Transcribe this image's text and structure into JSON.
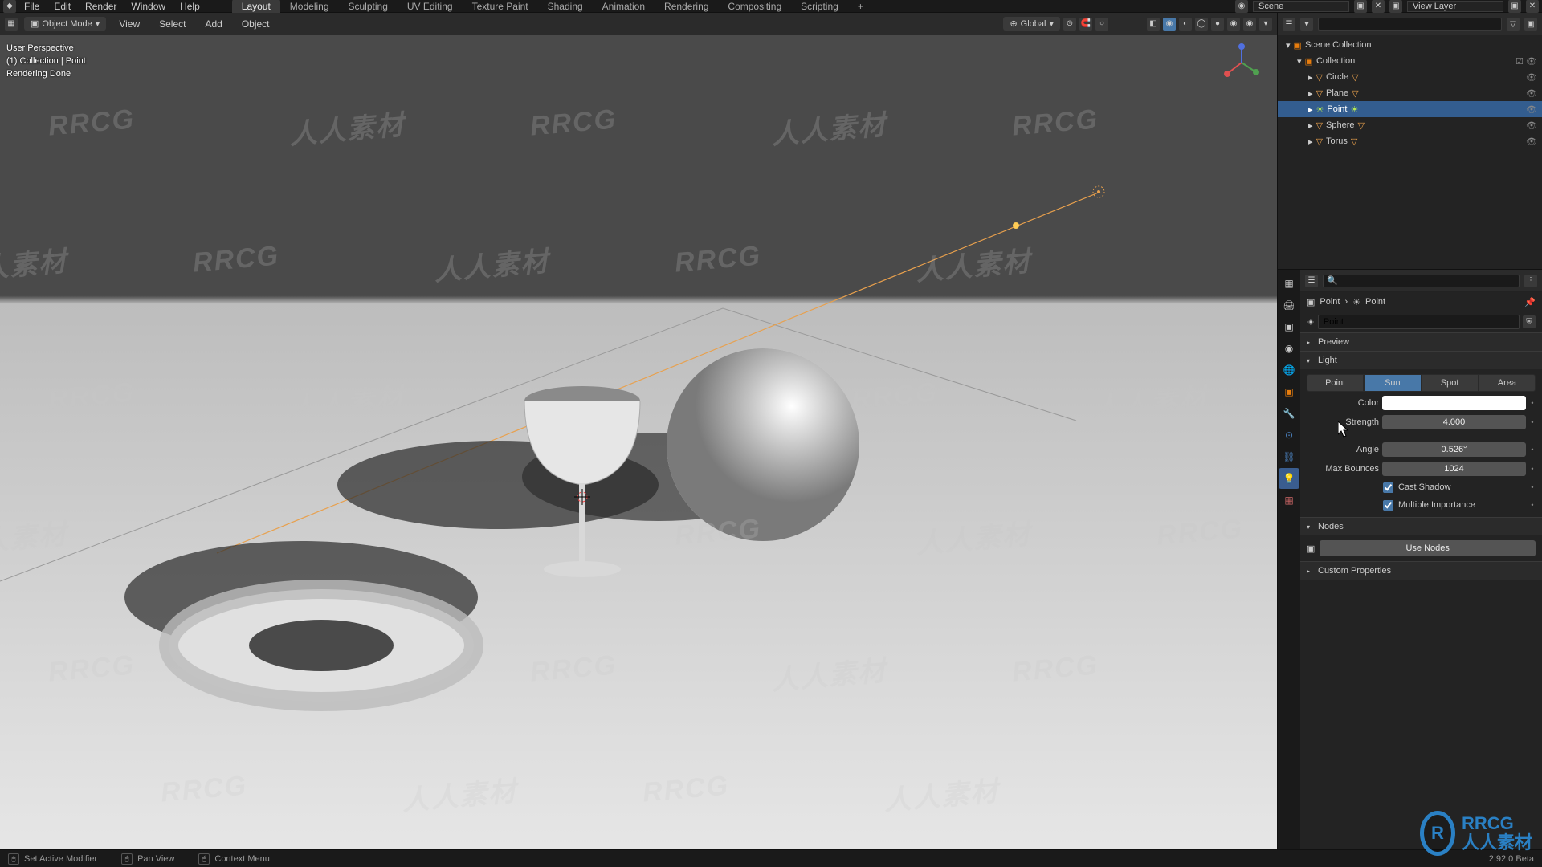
{
  "menubar": {
    "file": "File",
    "edit": "Edit",
    "render": "Render",
    "window": "Window",
    "help": "Help"
  },
  "workspaces": {
    "tabs": [
      "Layout",
      "Modeling",
      "Sculpting",
      "UV Editing",
      "Texture Paint",
      "Shading",
      "Animation",
      "Rendering",
      "Compositing",
      "Scripting"
    ],
    "active": "Layout",
    "add": "+"
  },
  "topright": {
    "scene_field": "Scene",
    "viewlayer_field": "View Layer"
  },
  "viewport_header": {
    "mode": "Object Mode",
    "view": "View",
    "select": "Select",
    "add": "Add",
    "object": "Object",
    "orientation": "Global"
  },
  "overlay": {
    "line1": "User Perspective",
    "line2": "(1) Collection | Point",
    "line3": "Rendering Done"
  },
  "outliner": {
    "root": "Scene Collection",
    "collection": "Collection",
    "items": [
      {
        "name": "Circle",
        "type": "mesh"
      },
      {
        "name": "Plane",
        "type": "mesh"
      },
      {
        "name": "Point",
        "type": "light",
        "selected": true
      },
      {
        "name": "Sphere",
        "type": "mesh"
      },
      {
        "name": "Torus",
        "type": "mesh"
      }
    ]
  },
  "properties": {
    "breadcrumb": {
      "obj": "Point",
      "data": "Point"
    },
    "name": "Point",
    "sections": {
      "preview": "Preview",
      "light": "Light",
      "nodes": "Nodes",
      "custom": "Custom Properties"
    },
    "light_types": [
      "Point",
      "Sun",
      "Spot",
      "Area"
    ],
    "light_type_active": "Sun",
    "color_label": "Color",
    "strength_label": "Strength",
    "strength": "4.000",
    "angle_label": "Angle",
    "angle": "0.526°",
    "bounces_label": "Max Bounces",
    "bounces": "1024",
    "cast_shadow": "Cast Shadow",
    "multi_importance": "Multiple Importance",
    "use_nodes": "Use Nodes"
  },
  "statusbar": {
    "set_modifier": "Set Active Modifier",
    "pan": "Pan View",
    "context": "Context Menu",
    "version": "2.92.0 Beta"
  },
  "watermark": {
    "text_en": "RRCG",
    "text_cn": "人人素材"
  },
  "logo": {
    "initials": "R",
    "text": "RRCG\n人人素材"
  }
}
